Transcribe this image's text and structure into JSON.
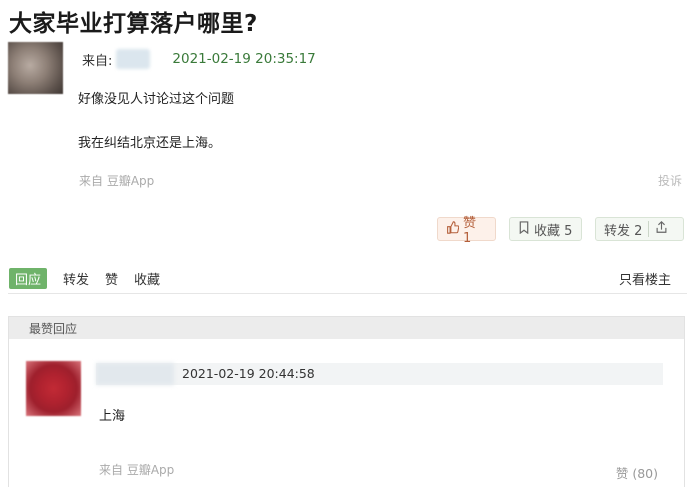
{
  "post": {
    "title": "大家毕业打算落户哪里?",
    "from_label": "来自:",
    "date": "2021-02-19 20:35:17",
    "lines": [
      "好像没见人讨论过这个问题",
      "我在纠结北京还是上海。"
    ],
    "source": "来自 豆瓣App",
    "report": "投诉"
  },
  "actions": {
    "like_label": "赞 1",
    "collect_label": "收藏 5",
    "share_label": "转发 2",
    "like_icon": "thumbs-up-icon",
    "collect_icon": "bookmark-icon",
    "share_icon": "share-icon"
  },
  "tabs": {
    "items": [
      "回应",
      "转发",
      "赞",
      "收藏"
    ],
    "active": "回应",
    "only_op": "只看楼主"
  },
  "best": {
    "header": "最赞回应",
    "reply": {
      "date": "2021-02-19 20:44:58",
      "text": "上海",
      "source": "来自 豆瓣App",
      "like_label": "赞 (80)"
    }
  },
  "colors": {
    "accent_green": "#6fb36a",
    "date_green": "#3a7a3a",
    "like_orange": "#b45f3a"
  }
}
